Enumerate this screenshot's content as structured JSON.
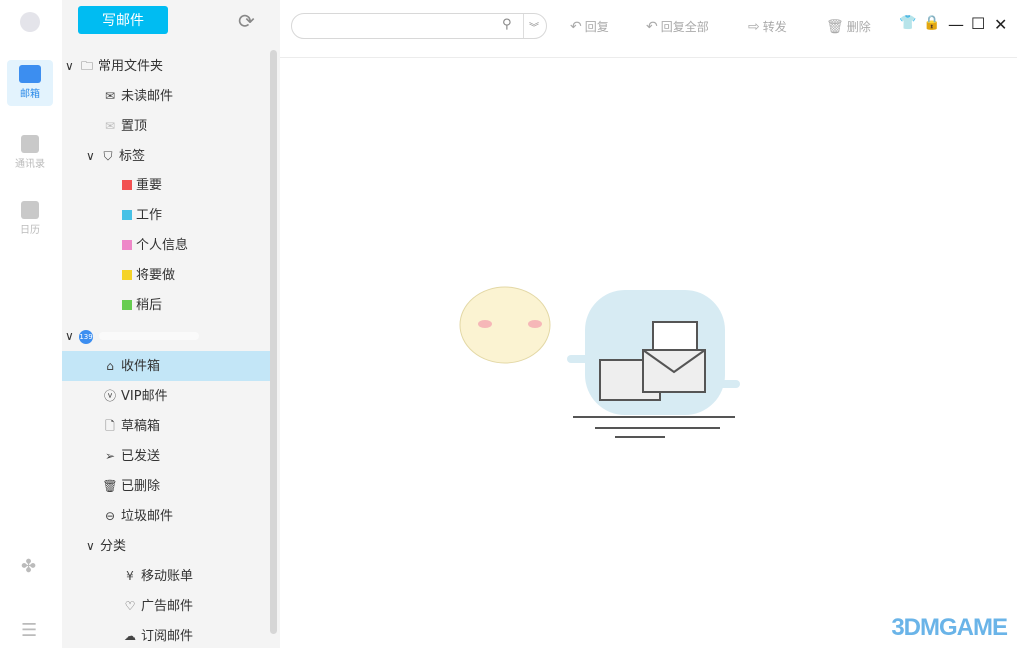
{
  "rail": {
    "mail": "邮箱",
    "contacts": "通讯录",
    "calendar": "日历"
  },
  "sidebar": {
    "compose": "写邮件",
    "favorites": {
      "label": "常用文件夹",
      "items": [
        "未读邮件",
        "置顶"
      ]
    },
    "tags": {
      "label": "标签",
      "items": [
        {
          "label": "重要",
          "color": "#f25151"
        },
        {
          "label": "工作",
          "color": "#46c1e6"
        },
        {
          "label": "个人信息",
          "color": "#ee87c8"
        },
        {
          "label": "将要做",
          "color": "#f5d327"
        },
        {
          "label": "稍后",
          "color": "#67cd51"
        }
      ]
    },
    "account": {
      "badge": "139"
    },
    "folders": [
      "收件箱",
      "VIP邮件",
      "草稿箱",
      "已发送",
      "已删除",
      "垃圾邮件"
    ],
    "category": {
      "label": "分类",
      "items": [
        "移动账单",
        "广告邮件",
        "订阅邮件"
      ]
    }
  },
  "toolbar": {
    "search_placeholder": "",
    "reply": "回复",
    "reply_all": "回复全部",
    "forward": "转发",
    "delete": "删除"
  },
  "watermark": "3DMGAME"
}
